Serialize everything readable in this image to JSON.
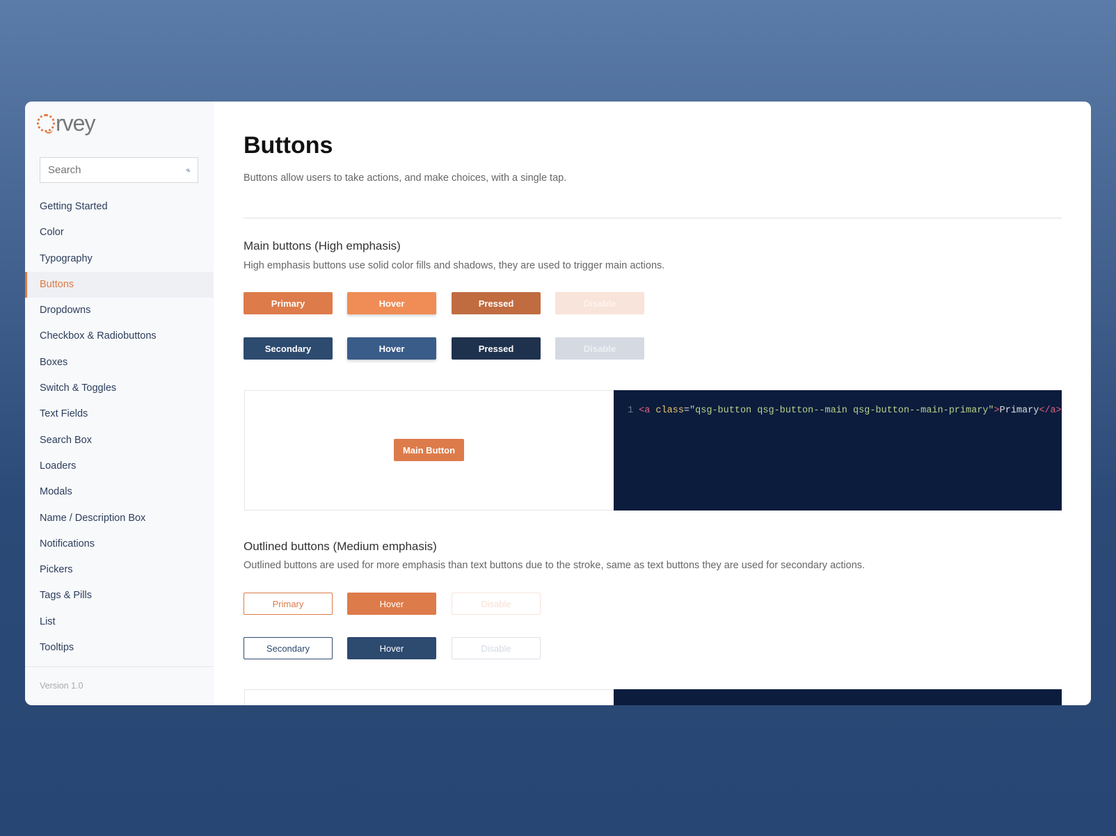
{
  "logo": {
    "text": "rvey",
    "full": "Qrvey"
  },
  "search": {
    "placeholder": "Search",
    "icon": "search-icon"
  },
  "nav": [
    "Getting Started",
    "Color",
    "Typography",
    "Buttons",
    "Dropdowns",
    "Checkbox & Radiobuttons",
    "Boxes",
    "Switch & Toggles",
    "Text Fields",
    "Search Box",
    "Loaders",
    "Modals",
    "Name / Description Box",
    "Notifications",
    "Pickers",
    "Tags & Pills",
    "List",
    "Tooltips"
  ],
  "active_nav": "Buttons",
  "version": "Version 1.0",
  "page": {
    "title": "Buttons",
    "subtitle": "Buttons allow users to take actions, and make choices, with a single tap."
  },
  "main_section": {
    "title": "Main buttons (High emphasis)",
    "desc": "High emphasis buttons use solid color fills and shadows, they are used to trigger main actions.",
    "primary": [
      "Primary",
      "Hover",
      "Pressed",
      "Disable"
    ],
    "secondary": [
      "Secondary",
      "Hover",
      "Pressed",
      "Disable"
    ],
    "demo_button": "Main Button",
    "code": {
      "line": "1",
      "open": "<a",
      "attr": " class",
      "eq": "=",
      "value": "\"qsg-button qsg-button--main qsg-button--main-primary\"",
      "close": ">",
      "text": "Primary",
      "end": "</a>"
    }
  },
  "outlined_section": {
    "title": "Outlined buttons (Medium emphasis)",
    "desc": "Outlined buttons are used for more emphasis than text buttons due to the stroke, same as text buttons they are used for secondary actions.",
    "primary": [
      "Primary",
      "Hover",
      "Disable"
    ],
    "secondary": [
      "Secondary",
      "Hover",
      "Disable"
    ]
  },
  "colors": {
    "accent": "#dd7b4a",
    "primary_hover": "#f08c56",
    "primary_pressed": "#c06c40",
    "primary_disabled": "#f8e4da",
    "secondary": "#2d4a6f",
    "secondary_hover": "#3a5c89",
    "secondary_pressed": "#1f324d",
    "secondary_disabled": "#d5dae2",
    "code_bg": "#0b1c3d"
  }
}
